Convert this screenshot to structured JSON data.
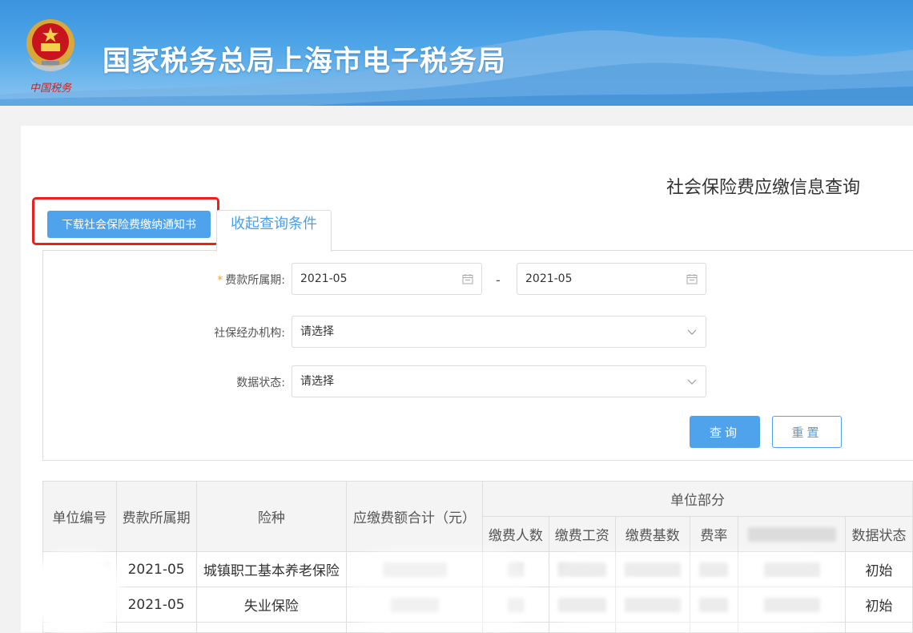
{
  "header": {
    "site_title": "国家税务总局上海市电子税务局",
    "emblem_text": "中国税务",
    "colors": {
      "sky": "#3b93de",
      "mountain": "#7fb6e6"
    }
  },
  "page": {
    "title": "社会保险费应缴信息查询"
  },
  "toolbar": {
    "download_label": "下载社会保险费缴纳通知书",
    "collapse_tab_label": "收起查询条件",
    "highlight_color": "#e8211d"
  },
  "filters": {
    "period": {
      "label": "费款所属期:",
      "required_mark": "*",
      "start_value": "2021-05",
      "separator": "-",
      "end_value": "2021-05",
      "icon": "calendar-icon"
    },
    "agency": {
      "label": "社保经办机构:",
      "value": "请选择",
      "icon": "chevron-down-icon"
    },
    "status": {
      "label": "数据状态:",
      "value": "请选择",
      "icon": "chevron-down-icon"
    },
    "query_label": "查询",
    "reset_label": "重置"
  },
  "table": {
    "headers": {
      "unit_no": "单位编号",
      "period": "费款所属期",
      "insurance_type": "险种",
      "total_due": "应缴费额合计（元）",
      "unit_part": "单位部分",
      "payers": "缴费人数",
      "wages": "缴费工资",
      "base": "缴费基数",
      "rate": "费率",
      "status": "数据状态"
    },
    "rows": [
      {
        "period": "2021-05",
        "insurance_type": "城镇职工基本养老保险",
        "status": "初始"
      },
      {
        "period": "2021-05",
        "insurance_type": "失业保险",
        "status": "初始"
      }
    ]
  }
}
